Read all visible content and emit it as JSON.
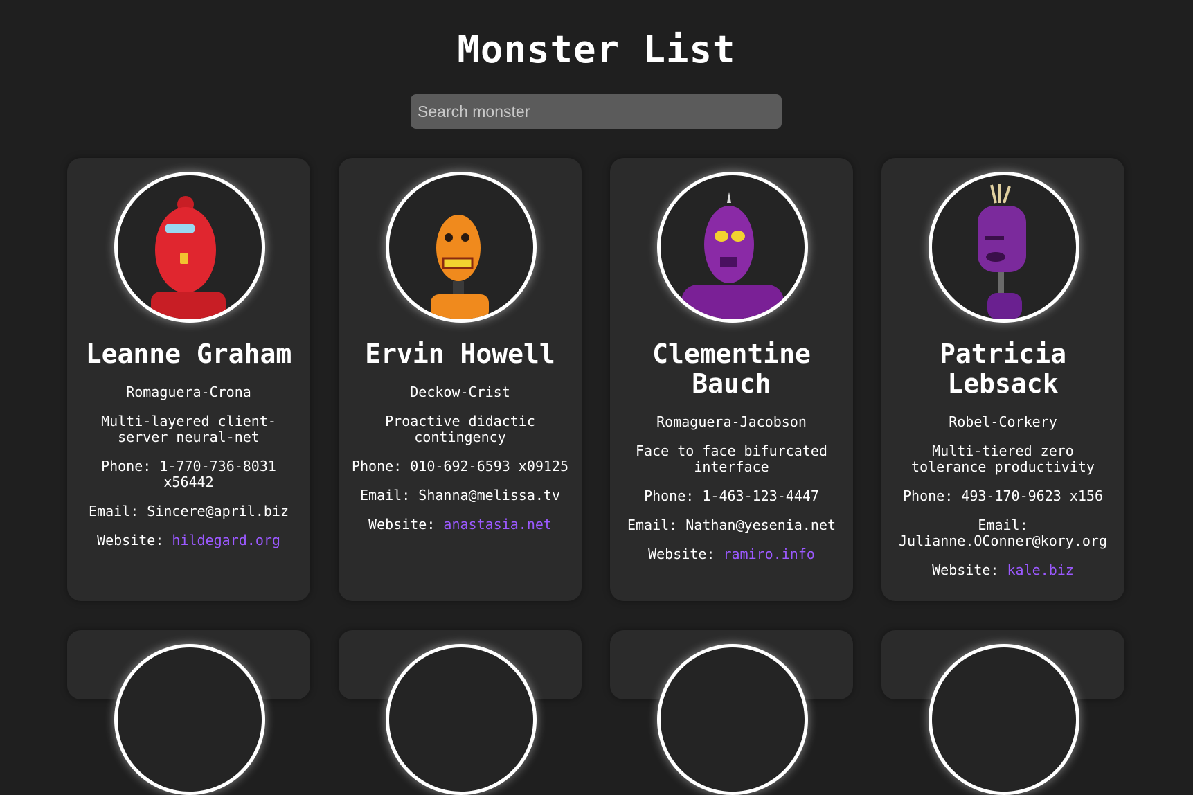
{
  "page": {
    "title": "Monster List"
  },
  "search": {
    "placeholder": "Search monster"
  },
  "monsters": [
    {
      "name": "Leanne Graham",
      "company": "Romaguera-Crona",
      "catch_phrase": "Multi-layered client-server neural-net",
      "phone_label": "Phone:",
      "phone": "1-770-736-8031 x56442",
      "email_label": "Email:",
      "email": "Sincere@april.biz",
      "website_label": "Website:",
      "website": "hildegard.org",
      "avatar_icon": "red-robot-icon",
      "color": "#e0262f"
    },
    {
      "name": "Ervin Howell",
      "company": "Deckow-Crist",
      "catch_phrase": "Proactive didactic contingency",
      "phone_label": "Phone:",
      "phone": "010-692-6593 x09125",
      "email_label": "Email:",
      "email": "Shanna@melissa.tv",
      "website_label": "Website:",
      "website": "anastasia.net",
      "avatar_icon": "orange-robot-icon",
      "color": "#f08a1d"
    },
    {
      "name": "Clementine Bauch",
      "company": "Romaguera-Jacobson",
      "catch_phrase": "Face to face bifurcated interface",
      "phone_label": "Phone:",
      "phone": "1-463-123-4447",
      "email_label": "Email:",
      "email": "Nathan@yesenia.net",
      "website_label": "Website:",
      "website": "ramiro.info",
      "avatar_icon": "purple-robot-icon",
      "color": "#8a2aa6"
    },
    {
      "name": "Patricia Lebsack",
      "company": "Robel-Corkery",
      "catch_phrase": "Multi-tiered zero tolerance productivity",
      "phone_label": "Phone:",
      "phone": "493-170-9623 x156",
      "email_label": "Email:",
      "email": "Julianne.OConner@kory.org",
      "website_label": "Website:",
      "website": "kale.biz",
      "avatar_icon": "violet-robot-icon",
      "color": "#7b2a9c"
    }
  ],
  "colors": {
    "background": "#1f1f1f",
    "card": "#2b2b2b",
    "link": "#9b59ff",
    "search": "#5b5b5b"
  }
}
